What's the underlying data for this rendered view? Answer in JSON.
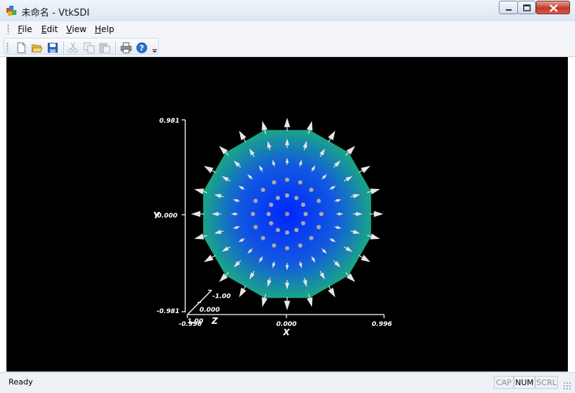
{
  "window": {
    "title": "未命名 - VtkSDI"
  },
  "menu": [
    {
      "key": "F",
      "rest": "ile"
    },
    {
      "key": "E",
      "rest": "dit"
    },
    {
      "key": "V",
      "rest": "iew"
    },
    {
      "key": "H",
      "rest": "elp"
    }
  ],
  "toolbar": [
    {
      "icon": "new-document-icon",
      "enabled": true
    },
    {
      "icon": "open-folder-icon",
      "enabled": true
    },
    {
      "icon": "save-icon",
      "enabled": true
    },
    {
      "icon": "cut-icon",
      "enabled": false
    },
    {
      "icon": "copy-icon",
      "enabled": false
    },
    {
      "icon": "paste-icon",
      "enabled": false
    },
    {
      "icon": "print-icon",
      "enabled": true
    },
    {
      "icon": "help-icon",
      "enabled": true
    }
  ],
  "viewport": {
    "background": "#000000",
    "axes": {
      "y_label": "Y",
      "y_ticks": [
        "0.981",
        "0.000",
        "-0.981"
      ],
      "x_label": "X",
      "x_ticks": [
        "-0.996",
        "0.000",
        "0.996"
      ],
      "z_label": "Z",
      "z_ticks": [
        "-1.00",
        "0.000",
        "1.00"
      ]
    },
    "disk": {
      "colors": {
        "center": "#0026ff",
        "mid": "#1258e0",
        "edge": "#1aa38a"
      },
      "sides": 12
    },
    "glyphs": {
      "color": "#e6e6e6",
      "ring_counts": [
        1,
        12,
        16,
        24,
        24,
        24
      ]
    }
  },
  "status": {
    "text": "Ready",
    "indicators": {
      "cap": "CAP",
      "num": "NUM",
      "scrl": "SCRL"
    }
  }
}
